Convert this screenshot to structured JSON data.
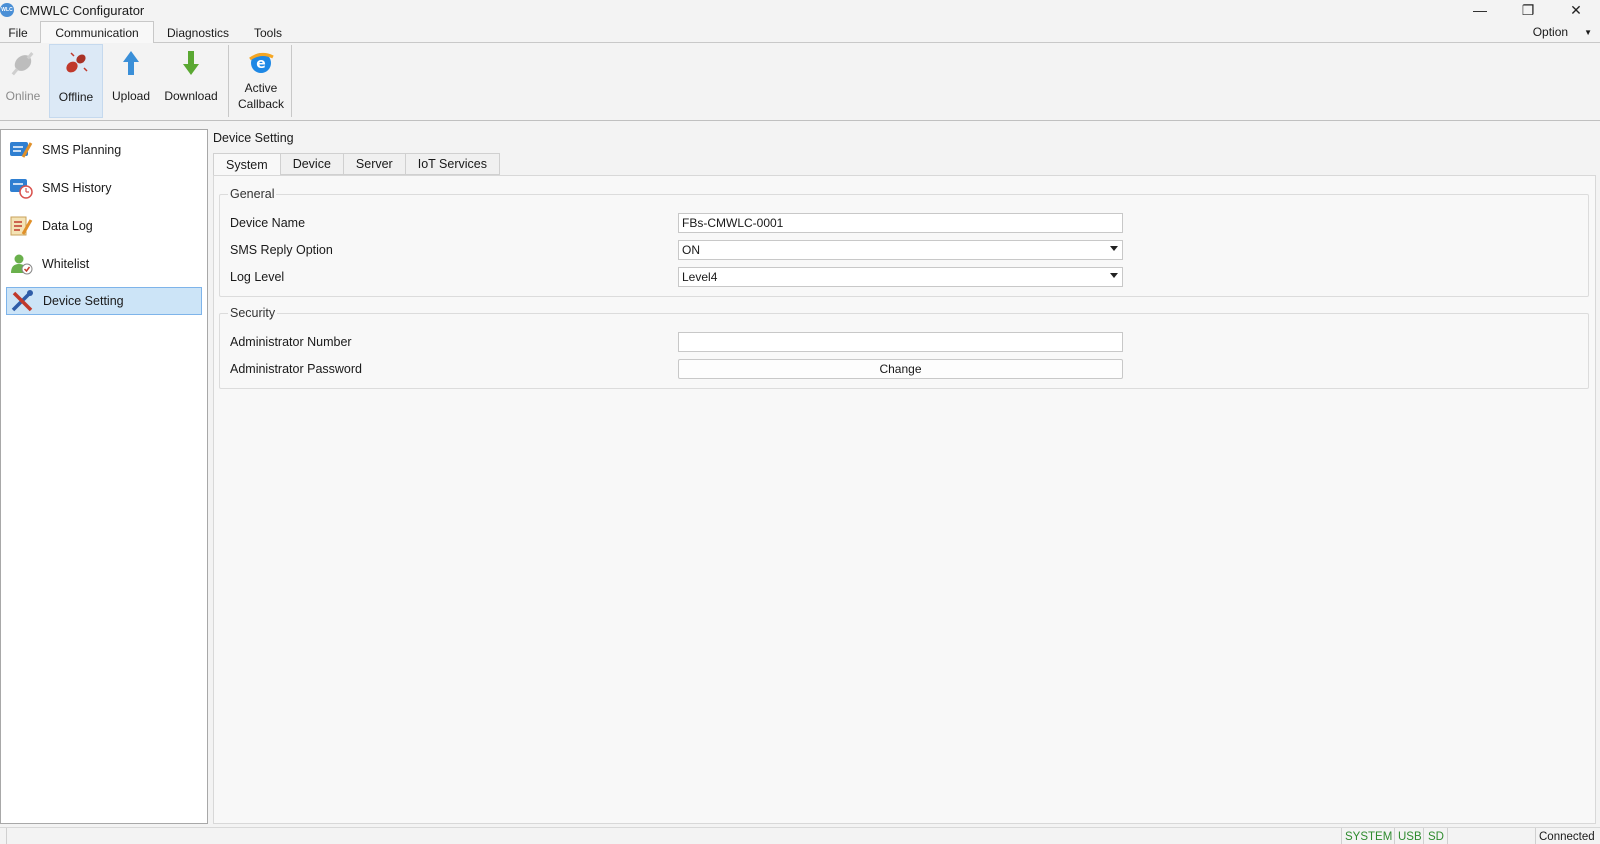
{
  "window": {
    "title": "CMWLC Configurator",
    "icon_text": "WLC",
    "controls": {
      "minimize": "—",
      "restore": "❐",
      "close": "✕"
    }
  },
  "menu": {
    "tabs": [
      "File",
      "Communication",
      "Diagnostics",
      "Tools"
    ],
    "active": "Communication",
    "option_label": "Option"
  },
  "ribbon": {
    "buttons": [
      {
        "label": "Online",
        "icon": "plug-connect-icon",
        "state": "disabled"
      },
      {
        "label": "Offline",
        "icon": "plug-disconnect-icon",
        "state": "selected"
      },
      {
        "label": "Upload",
        "icon": "arrow-up-icon",
        "state": "normal"
      },
      {
        "label": "Download",
        "icon": "arrow-down-icon",
        "state": "normal"
      },
      {
        "label_line1": "Active",
        "label_line2": "Callback",
        "icon": "browser-e-icon",
        "state": "normal"
      }
    ]
  },
  "sidebar": {
    "items": [
      {
        "label": "SMS Planning",
        "icon": "sms-planning-icon"
      },
      {
        "label": "SMS History",
        "icon": "sms-history-icon"
      },
      {
        "label": "Data Log",
        "icon": "data-log-icon"
      },
      {
        "label": "Whitelist",
        "icon": "whitelist-user-icon"
      },
      {
        "label": "Device Setting",
        "icon": "tools-icon"
      }
    ],
    "active_index": 4
  },
  "main": {
    "section_title": "Device Setting",
    "tabs": [
      "System",
      "Device",
      "Server",
      "IoT Services"
    ],
    "active_tab": "System",
    "general": {
      "legend": "General",
      "device_name_label": "Device Name",
      "device_name_value": "FBs-CMWLC-0001",
      "sms_reply_label": "SMS Reply Option",
      "sms_reply_value": "ON",
      "log_level_label": "Log Level",
      "log_level_value": "Level4"
    },
    "security": {
      "legend": "Security",
      "admin_number_label": "Administrator Number",
      "admin_number_value": "",
      "admin_password_label": "Administrator Password",
      "change_button": "Change"
    }
  },
  "status": {
    "system": "SYSTEM",
    "usb": "USB",
    "sd": "SD",
    "connection": "Connected"
  },
  "colors": {
    "accent_selected": "#cce4f7",
    "status_green": "#2e8b2e"
  }
}
